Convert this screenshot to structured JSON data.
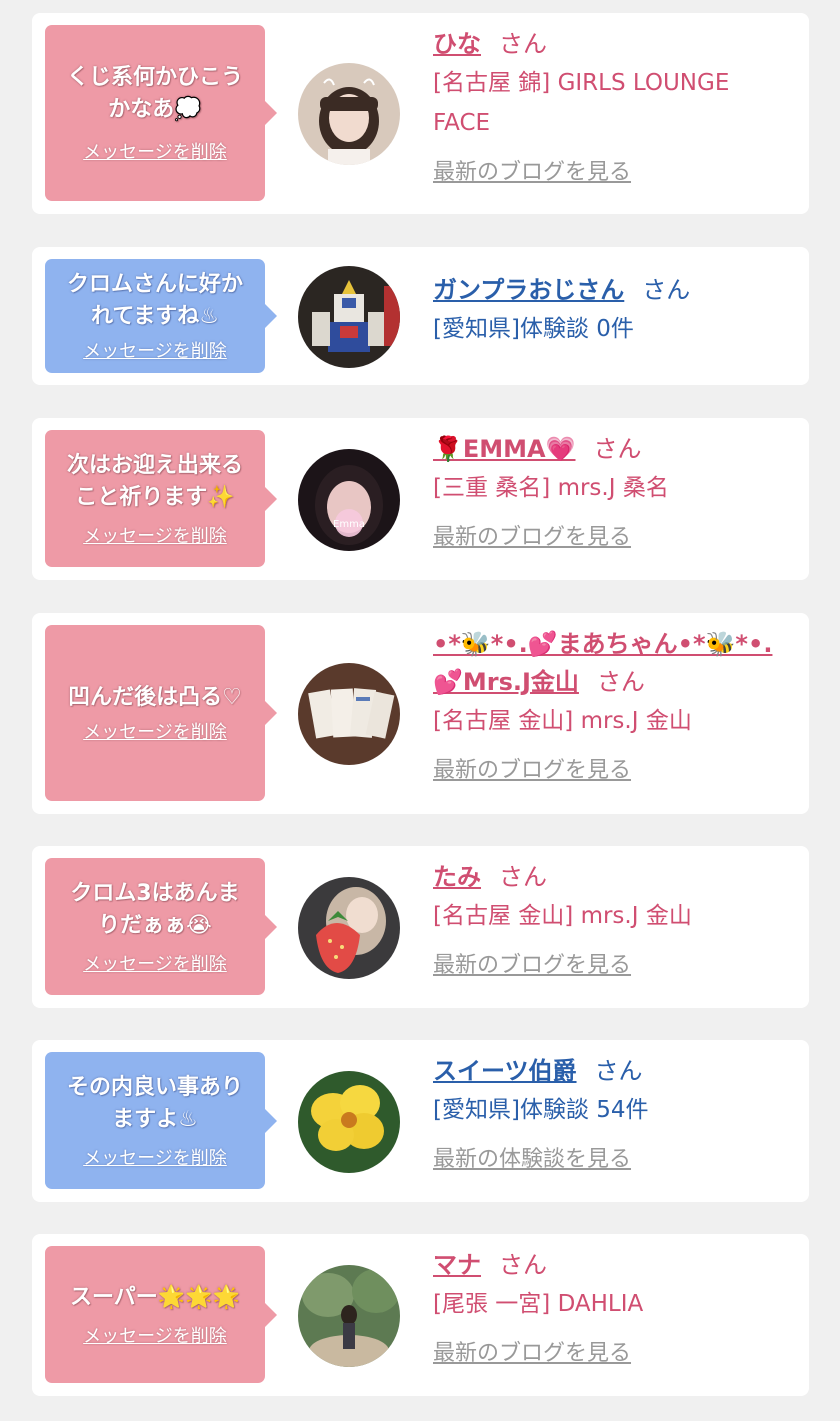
{
  "colors": {
    "pink_bubble": "#ee9aa6",
    "blue_bubble": "#8fb3ef",
    "pink_text": "#d04e71",
    "blue_text": "#2a5faa",
    "gray_link": "#999999"
  },
  "san_label": "さん",
  "delete_label": "メッセージを削除",
  "cards": [
    {
      "bubble_color": "pink",
      "message": "くじ系何かひこう\nかなあ💭",
      "name": "ひな",
      "place": "[名古屋 錦] GIRLS LOUNGE FACE",
      "link": "最新のブログを見る",
      "avatar_icon": "girl-portrait-avatar"
    },
    {
      "bubble_color": "blue",
      "message": "クロムさんに好か\nれてますね♨",
      "name": "ガンプラおじさん",
      "place": "[愛知県]体験談 0件",
      "link": "",
      "avatar_icon": "gundam-model-avatar"
    },
    {
      "bubble_color": "pink",
      "message": "次はお迎え出来る\nこと祈ります✨",
      "name": "🌹EMMA💗",
      "place": "[三重 桑名] mrs.J 桑名",
      "link": "最新のブログを見る",
      "avatar_icon": "emma-portrait-avatar"
    },
    {
      "bubble_color": "pink",
      "message": "凹んだ後は凸る♡",
      "name": "•*🐝*•.💕まあちゃん•*🐝*•.💕Mrs.J金山",
      "place": "[名古屋 金山] mrs.J 金山",
      "link": "最新のブログを見る",
      "avatar_icon": "cards-photo-avatar"
    },
    {
      "bubble_color": "pink",
      "message": "クロム3はあんま\nりだぁぁ😭",
      "name": "たみ",
      "place": "[名古屋 金山] mrs.J 金山",
      "link": "最新のブログを見る",
      "avatar_icon": "strawberry-girl-avatar"
    },
    {
      "bubble_color": "blue",
      "message": "その内良い事あり\nますよ♨",
      "name": "スイーツ伯爵",
      "place": "[愛知県]体験談 54件",
      "link": "最新の体験談を見る",
      "avatar_icon": "yellow-flower-avatar"
    },
    {
      "bubble_color": "pink",
      "message": "スーパー🌟🌟🌟",
      "name": "マナ",
      "place": "[尾張 一宮] DAHLIA",
      "link": "最新のブログを見る",
      "avatar_icon": "forest-girl-avatar"
    }
  ]
}
